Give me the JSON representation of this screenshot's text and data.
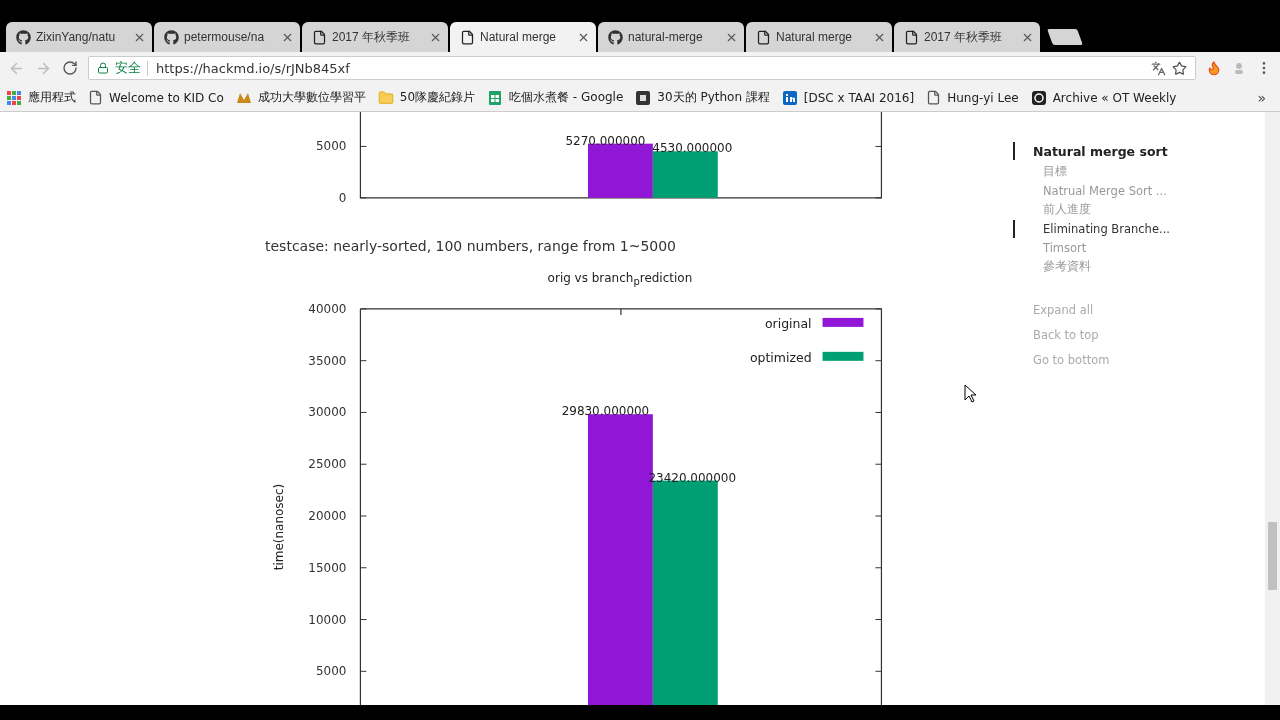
{
  "tabs": [
    {
      "kind": "github",
      "label": "ZixinYang/natu",
      "selected": false
    },
    {
      "kind": "github",
      "label": "petermouse/na",
      "selected": false
    },
    {
      "kind": "document",
      "label": "2017 年秋季班",
      "selected": false
    },
    {
      "kind": "document",
      "label": "Natural merge",
      "selected": true
    },
    {
      "kind": "github",
      "label": "natural-merge",
      "selected": false
    },
    {
      "kind": "document",
      "label": "Natural merge",
      "selected": false
    },
    {
      "kind": "document",
      "label": "2017 年秋季班",
      "selected": false
    }
  ],
  "toolbar": {
    "security": "安全",
    "url": "https://hackmd.io/s/rJNb845xf"
  },
  "bookmarks": [
    {
      "kind": "apps",
      "label": "應用程式"
    },
    {
      "kind": "page",
      "label": "Welcome to KID Co"
    },
    {
      "kind": "logo",
      "label": "成功大學數位學習平"
    },
    {
      "kind": "folder",
      "label": "50隊慶紀錄片"
    },
    {
      "kind": "sheet",
      "label": "吃個水煮餐 - Google"
    },
    {
      "kind": "square",
      "label": "30天的 Python 課程"
    },
    {
      "kind": "linkedin",
      "label": "[DSC x TAAI 2016]"
    },
    {
      "kind": "page",
      "label": "Hung-yi Lee"
    },
    {
      "kind": "circle",
      "label": "Archive « OT Weekly"
    }
  ],
  "bookmarks_more": "»",
  "content": [
    {
      "kind": "chart",
      "chart_data": {
        "type": "bar",
        "ylim": [
          0,
          8350
        ],
        "yticks": [
          0,
          5000
        ],
        "series": [
          {
            "color": "#9116d6",
            "values": [
              5270
            ]
          },
          {
            "color": "#009e73",
            "values": [
              4530
            ]
          }
        ],
        "value_labels": [
          "5270.000000",
          "4530.000000"
        ]
      }
    },
    {
      "kind": "text",
      "text": "testcase: nearly-sorted, 100 numbers, range from 1~5000"
    },
    {
      "kind": "chart",
      "chart_data": {
        "type": "bar",
        "title": "orig vs branch$_{p}$rediction",
        "ylabel": "time(nanosec)",
        "ylim": [
          0,
          40000
        ],
        "yticks": [
          5000,
          10000,
          15000,
          20000,
          25000,
          30000,
          35000,
          40000
        ],
        "series": [
          {
            "name": "original",
            "color": "#9116d6",
            "values": [
              29830
            ]
          },
          {
            "name": "optimized",
            "color": "#009e73",
            "values": [
              23420
            ]
          }
        ],
        "legend": true,
        "value_labels": [
          "29830.000000",
          "23420.000000"
        ]
      }
    }
  ],
  "toc": {
    "title": "Natural merge sort",
    "active": true,
    "children": [
      {
        "label": "目標",
        "active": false
      },
      {
        "label": "Natrual Merge Sort ...",
        "active": false
      },
      {
        "label": "前人進度",
        "active": false
      },
      {
        "label": "Eliminating Branche...",
        "active": true
      },
      {
        "label": "Timsort",
        "active": false
      },
      {
        "label": "參考資料",
        "active": false
      }
    ],
    "links": [
      "Expand all",
      "Back to top",
      "Go to bottom"
    ]
  }
}
